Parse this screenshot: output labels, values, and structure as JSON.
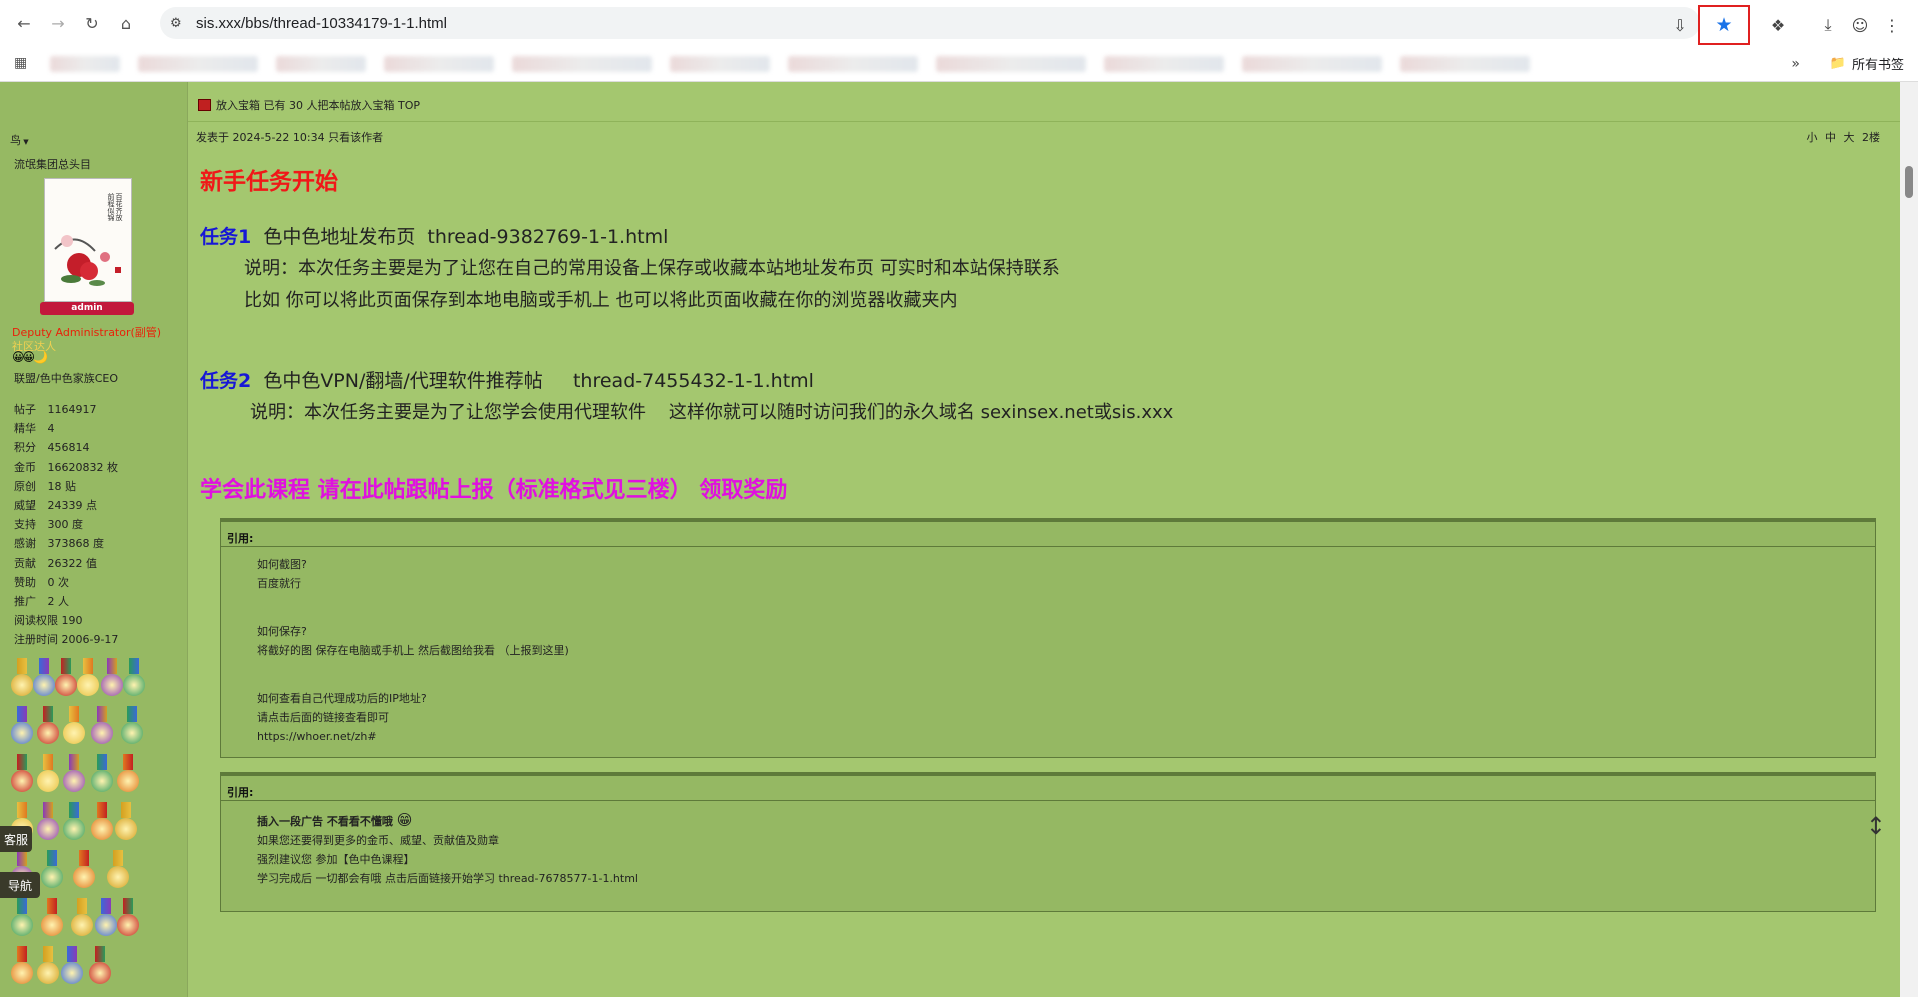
{
  "browser": {
    "url": "sis.xxx/bbs/thread-10334179-1-1.html",
    "bookmarks_all_label": "所有书签",
    "more_label": "»"
  },
  "sidebar": {
    "username": "鸟",
    "user_title": "流氓集团总头目",
    "admin_badge": "admin",
    "group": "Deputy Administrator(副管)",
    "online_status": "社区达人",
    "affiliation": "联盟/色中色家族CEO",
    "stats": [
      {
        "key": "帖子",
        "value": "1164917"
      },
      {
        "key": "精华",
        "value": "4"
      },
      {
        "key": "积分",
        "value": "456814"
      },
      {
        "key": "金币",
        "value": "16620832 枚"
      },
      {
        "key": "原创",
        "value": "18 贴"
      },
      {
        "key": "威望",
        "value": "24339 点"
      },
      {
        "key": "支持",
        "value": "300 度"
      },
      {
        "key": "感谢",
        "value": "373868 度"
      },
      {
        "key": "贡献",
        "value": "26322 值"
      },
      {
        "key": "赞助",
        "value": "0 次"
      },
      {
        "key": "推广",
        "value": "2 人"
      },
      {
        "key": "阅读权限",
        "value": "190"
      },
      {
        "key": "注册时间",
        "value": "2006-9-17"
      }
    ],
    "float_kefu": "客服",
    "float_nav": "导航"
  },
  "post": {
    "topline": "放入宝箱 已有 30 人把本帖放入宝箱 TOP",
    "posted": "发表于 2024-5-22 10:34  只看该作者",
    "sizes_floor": "小 中 大  2楼",
    "heading": "新手任务开始",
    "task1": {
      "tag": "任务1",
      "text": "  色中色地址发布页  thread-9382769-1-1.html"
    },
    "task1_desc1": "说明：本次任务主要是为了让您在自己的常用设备上保存或收藏本站地址发布页 可实时和本站保持联系",
    "task1_desc2": "比如 你可以将此页面保存到本地电脑或手机上  也可以将此页面收藏在你的浏览器收藏夹内",
    "task2": {
      "tag": "任务2",
      "text": "  色中色VPN/翻墙/代理软件推荐帖     thread-7455432-1-1.html"
    },
    "task2_desc": "说明：本次任务主要是为了让您学会使用代理软件    这样你就可以随时访问我们的永久域名 sexinsex.net或sis.xxx",
    "learn": "学会此课程 请在此帖跟帖上报（标准格式见三楼） 领取奖励",
    "quote1": {
      "head": "引用:",
      "lines": [
        "如何截图?",
        "百度就行",
        "",
        "",
        "如何保存?",
        "将截好的图 保存在电脑或手机上  然后截图给我看 （上报到这里)",
        "",
        "",
        "如何查看自己代理成功后的IP地址?",
        "请点击后面的链接查看即可",
        "https://whoer.net/zh#"
      ]
    },
    "quote2": {
      "head": "引用:",
      "bold_line": "插入一段广告 不看看不懂哦",
      "lines": [
        "如果您还要得到更多的金币、威望、贡献值及勋章",
        "强烈建议您  参加【色中色课程】",
        "学习完成后  一切都会有哦   点击后面链接开始学习  thread-7678577-1-1.html"
      ]
    }
  },
  "colors": {
    "page_bg": "#a4c76f",
    "sidebar_bg": "#96b963",
    "heading_red": "#f01818",
    "task_blue": "#1717d6",
    "learn_magenta": "#e010e0",
    "highlight_box": "#e02020",
    "star_blue": "#1a73e8"
  }
}
